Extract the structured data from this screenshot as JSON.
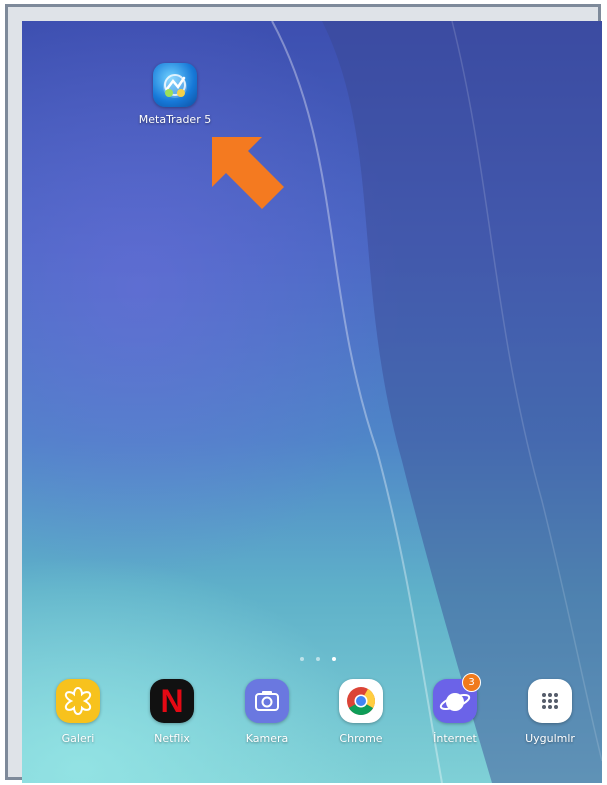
{
  "desktop": {
    "icons": [
      {
        "label": "MetaTrader 5"
      }
    ]
  },
  "dock": {
    "apps": [
      {
        "label": "Galeri"
      },
      {
        "label": "Netflix",
        "glyph": "N"
      },
      {
        "label": "Kamera"
      },
      {
        "label": "Chrome"
      },
      {
        "label": "İnternet",
        "badge": "3"
      },
      {
        "label": "Uygulmlr"
      }
    ]
  },
  "colors": {
    "arrow": "#f47a20",
    "galeri": "#f7c21d",
    "netflix_red": "#e50914",
    "kamera": "#6a78e0",
    "internet": "#6b63e8",
    "badge": "#f07a1c"
  }
}
